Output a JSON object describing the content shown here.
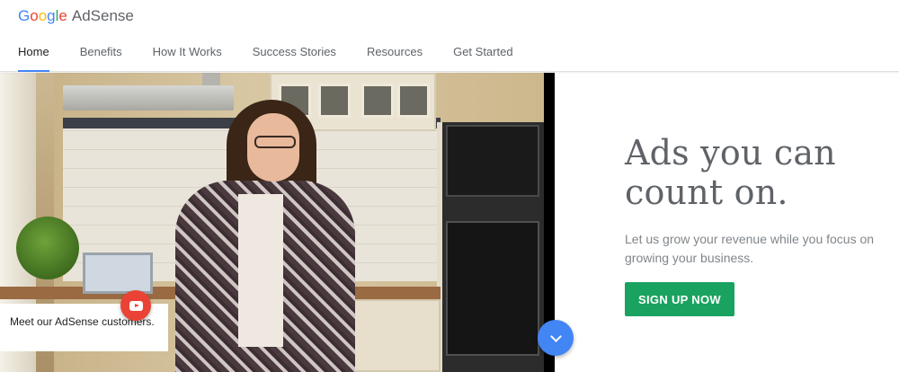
{
  "brand": {
    "google": [
      {
        "ch": "G",
        "color": "#4285f4"
      },
      {
        "ch": "o",
        "color": "#ea4335"
      },
      {
        "ch": "o",
        "color": "#fbbc05"
      },
      {
        "ch": "g",
        "color": "#4285f4"
      },
      {
        "ch": "l",
        "color": "#34a853"
      },
      {
        "ch": "e",
        "color": "#ea4335"
      }
    ],
    "product": "AdSense"
  },
  "nav": {
    "items": [
      "Home",
      "Benefits",
      "How It Works",
      "Success Stories",
      "Resources",
      "Get Started"
    ],
    "active": "Home"
  },
  "hero": {
    "caption": "Meet our AdSense customers.",
    "play_icon": "youtube-play-icon",
    "scroll_icon": "chevron-down-icon",
    "headline": "Ads you can count on.",
    "subtext": "Let us grow your revenue while you focus on growing your business.",
    "cta": "SIGN UP NOW"
  },
  "colors": {
    "accent_blue": "#4285f4",
    "play_red": "#ea4335",
    "cta_green": "#1aa260"
  }
}
